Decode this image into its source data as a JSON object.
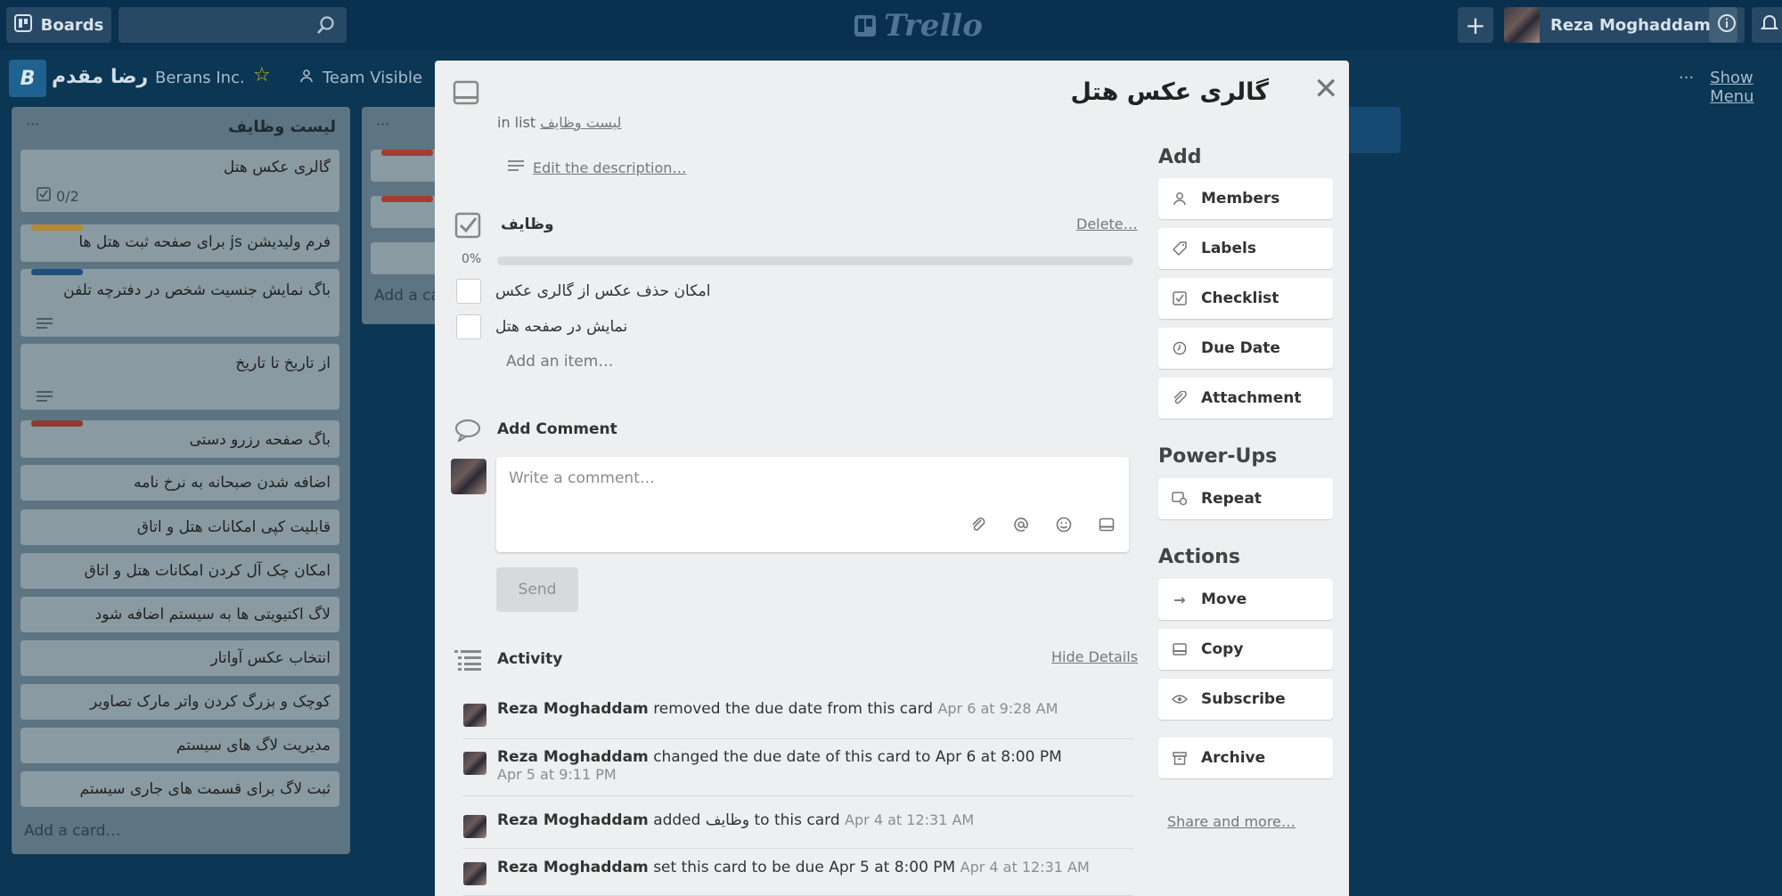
{
  "topbar": {
    "boards_label": "Boards",
    "app_name": "Trello",
    "user_name": "Reza Moghaddam"
  },
  "board": {
    "title": "رضا مقدم",
    "org": "Berans Inc.",
    "visibility": "Team Visible",
    "menu_dots": "···",
    "show_menu": "Show Menu"
  },
  "list1": {
    "title": "لیست وظایف",
    "dots": "···",
    "add_card": "Add a card…",
    "cards": [
      {
        "text": "گالری عکس هتل",
        "badge": "0/2",
        "label": ""
      },
      {
        "text": "فرم ولیدیشن js برای صفحه ثبت هتل ها",
        "label": "#e0a13c"
      },
      {
        "text": "باگ نمایش جنسیت شخص در دفترچه تلفن",
        "label": "#2b69a8"
      },
      {
        "text": "از تاریخ تا تاریخ",
        "label": ""
      },
      {
        "text": "باگ صفحه رزرو دستی",
        "label": "#b83b2e"
      },
      {
        "text": "اضافه شدن صبحانه به نرخ نامه",
        "label": ""
      },
      {
        "text": "قابلیت کپی امکانات هتل و اتاق",
        "label": ""
      },
      {
        "text": "امکان چک آل کردن امکانات هتل و اتاق",
        "label": ""
      },
      {
        "text": "لاگ اکتیویتی ها به سیستم اضافه شود",
        "label": ""
      },
      {
        "text": "انتخاب عکس آواتار",
        "label": ""
      },
      {
        "text": "کوچک و بزرگ کردن واتر مارک تصاویر",
        "label": ""
      },
      {
        "text": "مدیریت لاگ های سیستم",
        "label": ""
      },
      {
        "text": "ثبت لاگ برای قسمت های جاری سیستم",
        "label": ""
      }
    ]
  },
  "list2": {
    "dots": "···",
    "add_card": "Add a ca"
  },
  "modal": {
    "title": "گالری عکس هتل",
    "in_list_prefix": "in list",
    "list_name": "لیست وظایف",
    "edit_description": "Edit the description…",
    "checklist": {
      "title": "وظایف",
      "delete": "Delete…",
      "percent": "0%",
      "progress_fraction": 0,
      "items": [
        {
          "text": "امکان حذف عکس از گالری عکس",
          "checked": false
        },
        {
          "text": "نمایش در صفحه هتل",
          "checked": false
        }
      ],
      "add_item": "Add an item…"
    },
    "comment": {
      "title": "Add Comment",
      "placeholder": "Write a comment…",
      "send": "Send"
    },
    "activity": {
      "title": "Activity",
      "hide_details": "Hide Details",
      "entries": [
        {
          "user": "Reza Moghaddam",
          "action": "removed the due date from this card",
          "time": "Apr 6 at 9:28 AM"
        },
        {
          "user": "Reza Moghaddam",
          "action": "changed the due date of this card to Apr 6 at 8:00 PM",
          "time": "Apr 5 at 9:11 PM"
        },
        {
          "user": "Reza Moghaddam",
          "action": "added وظایف to this card",
          "time": "Apr 4 at 12:31 AM"
        },
        {
          "user": "Reza Moghaddam",
          "action": "set this card to be due Apr 5 at 8:00 PM",
          "time": "Apr 4 at 12:31 AM"
        }
      ]
    },
    "sidebar": {
      "add_heading": "Add",
      "add_buttons": [
        "Members",
        "Labels",
        "Checklist",
        "Due Date",
        "Attachment"
      ],
      "powerups_heading": "Power-Ups",
      "powerup_buttons": [
        "Repeat"
      ],
      "actions_heading": "Actions",
      "action_buttons": [
        "Move",
        "Copy",
        "Subscribe",
        "Archive"
      ],
      "share_more": "Share and more…"
    }
  }
}
